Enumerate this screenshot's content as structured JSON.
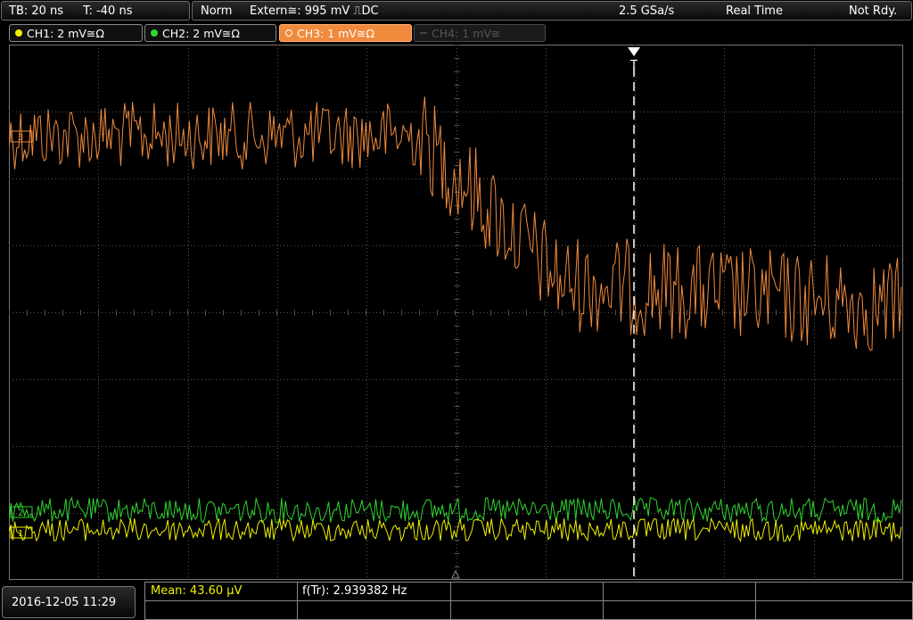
{
  "topbar": {
    "timebase": "TB: 20 ns",
    "trigger_time": "T: -40 ns",
    "mode": "Norm",
    "trigger_source": "Extern≅: 995 mV ⎍DC",
    "sample_rate": "2.5 GSa/s",
    "acq_mode": "Real Time",
    "status": "Not Rdy."
  },
  "channels": [
    {
      "label": "CH1: 2 mV≅Ω",
      "color": "#f0f000"
    },
    {
      "label": "CH2: 2 mV≅Ω",
      "color": "#2fd52f"
    },
    {
      "label": "CH3: 1 mV≅Ω",
      "color": "#f08a3c"
    },
    {
      "label": "CH4: 1 mV≅",
      "color": "#555555"
    }
  ],
  "markers": {
    "ch3": "3",
    "ch2": "2",
    "ch1": "1",
    "trigger": "T"
  },
  "bottombar": {
    "date": "2016-12-05 11:29",
    "mean": "Mean: 43.60 µV",
    "freq": "f(Tr): 2.939382 Hz"
  },
  "colors": {
    "grid": "#555555",
    "ch1": "#f0f000",
    "ch2": "#2fd52f",
    "ch3": "#f08a3c",
    "meas_text": "#f0f000"
  }
}
